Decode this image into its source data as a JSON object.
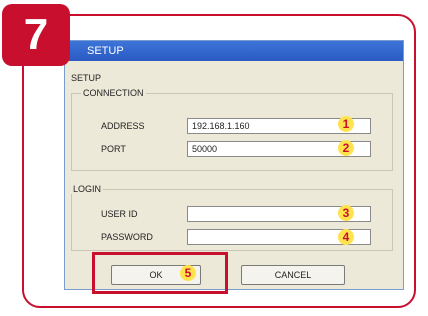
{
  "step": "7",
  "dialog": {
    "title": "SETUP",
    "section_title": "SETUP",
    "connection": {
      "group_label": "CONNECTION",
      "address_label": "ADDRESS",
      "address_value": "192.168.1.160",
      "port_label": "PORT",
      "port_value": "50000"
    },
    "login": {
      "group_label": "LOGIN",
      "user_id_label": "USER ID",
      "user_id_value": "",
      "password_label": "PASSWORD",
      "password_value": ""
    },
    "ok_label": "OK",
    "cancel_label": "CANCEL"
  },
  "markers": [
    "1",
    "2",
    "3",
    "4",
    "5"
  ],
  "colors": {
    "accent": "#c8102e",
    "marker": "#ffe34d",
    "titlebar": "#2a5bc4",
    "dialog_bg": "#ece9d8"
  }
}
